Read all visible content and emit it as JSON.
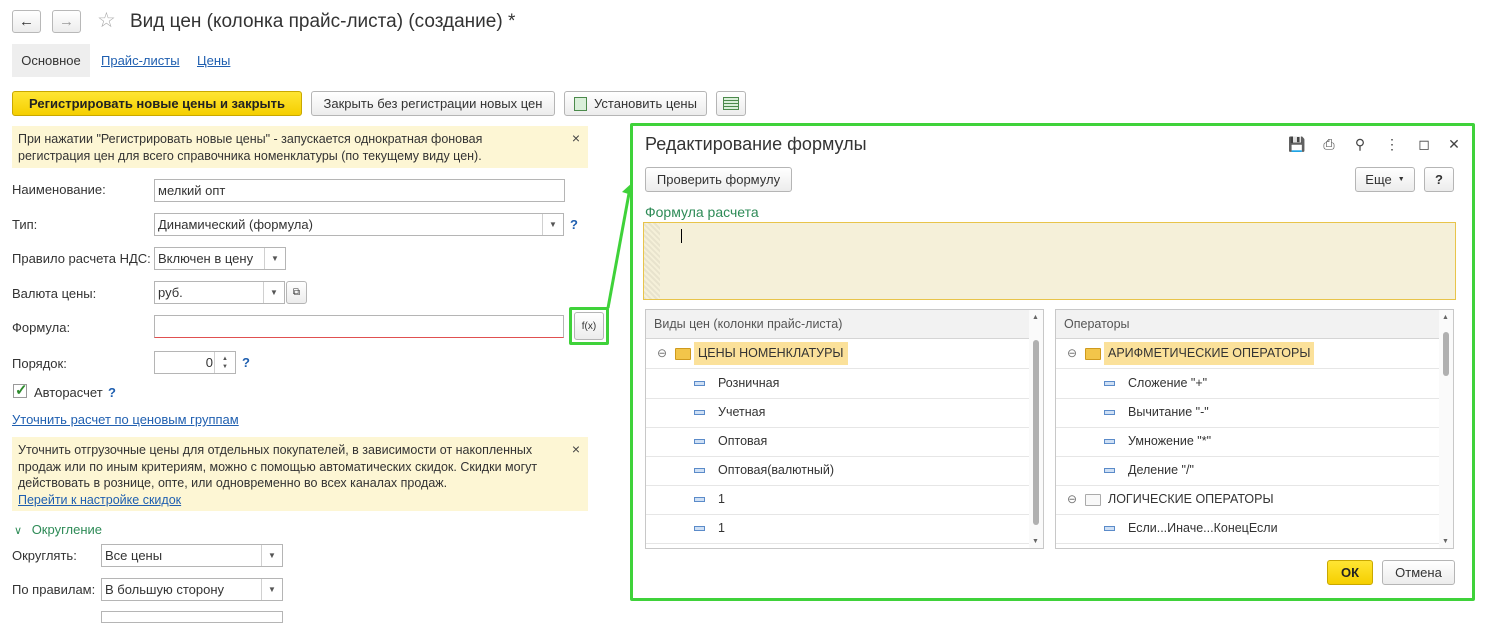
{
  "window": {
    "title": "Вид цен (колонка прайс-листа) (создание) *",
    "tabs": [
      "Основное",
      "Прайс-листы",
      "Цены"
    ]
  },
  "toolbar": {
    "register_close": "Регистрировать новые цены и закрыть",
    "close_no_register": "Закрыть без регистрации новых цен",
    "set_prices": "Установить цены"
  },
  "notice1": {
    "text": "При нажатии \"Регистрировать новые цены\" - запускается однократная фоновая регистрация цен для всего справочника номенклатуры (по текущему виду цен).",
    "close": "×"
  },
  "form": {
    "name_label": "Наименование:",
    "name_value": "мелкий опт",
    "type_label": "Тип:",
    "type_value": "Динамический (формула)",
    "vat_label": "Правило расчета НДС:",
    "vat_value": "Включен в цену",
    "currency_label": "Валюта цены:",
    "currency_value": "руб.",
    "formula_label": "Формула:",
    "formula_value": "",
    "formula_btn": "f(x)",
    "order_label": "Порядок:",
    "order_value": "0",
    "autocalc_label": "Авторасчет",
    "refine_link": "Уточнить расчет по ценовым группам",
    "help": "?"
  },
  "notice2": {
    "text": "Уточнить отгрузочные цены для отдельных покупателей, в зависимости от накопленных продаж или по иным критериям, можно с помощью автоматических скидок. Скидки могут действовать в рознице, опте, или одновременно во всех каналах продаж.",
    "link": "Перейти к настройке скидок",
    "close": "×"
  },
  "rounding": {
    "header": "Округление",
    "round_label": "Округлять:",
    "round_value": "Все цены",
    "rule_label": "По правилам:",
    "rule_value": "В большую сторону"
  },
  "dialog": {
    "title": "Редактирование формулы",
    "check_btn": "Проверить формулу",
    "more_btn": "Еще",
    "help_btn": "?",
    "formula_label": "Формула расчета",
    "ok": "ОК",
    "cancel": "Отмена",
    "left_panel": {
      "header": "Виды цен (колонки прайс-листа)",
      "group": "ЦЕНЫ НОМЕНКЛАТУРЫ",
      "items": [
        "Розничная",
        "Учетная",
        "Оптовая",
        "Оптовая(валютный)",
        "1",
        "1"
      ]
    },
    "right_panel": {
      "header": "Операторы",
      "group1": "АРИФМЕТИЧЕСКИЕ ОПЕРАТОРЫ",
      "items1": [
        "Сложение \"+\"",
        "Вычитание \"-\"",
        "Умножение \"*\"",
        "Деление \"/\""
      ],
      "group2": "ЛОГИЧЕСКИЕ ОПЕРАТОРЫ",
      "items2": [
        "Если...Иначе...КонецЕсли"
      ]
    }
  },
  "colors": {
    "accent_yellow": "#f5cf00",
    "highlight_green": "#3fd23a",
    "link_blue": "#1f5fb0"
  }
}
